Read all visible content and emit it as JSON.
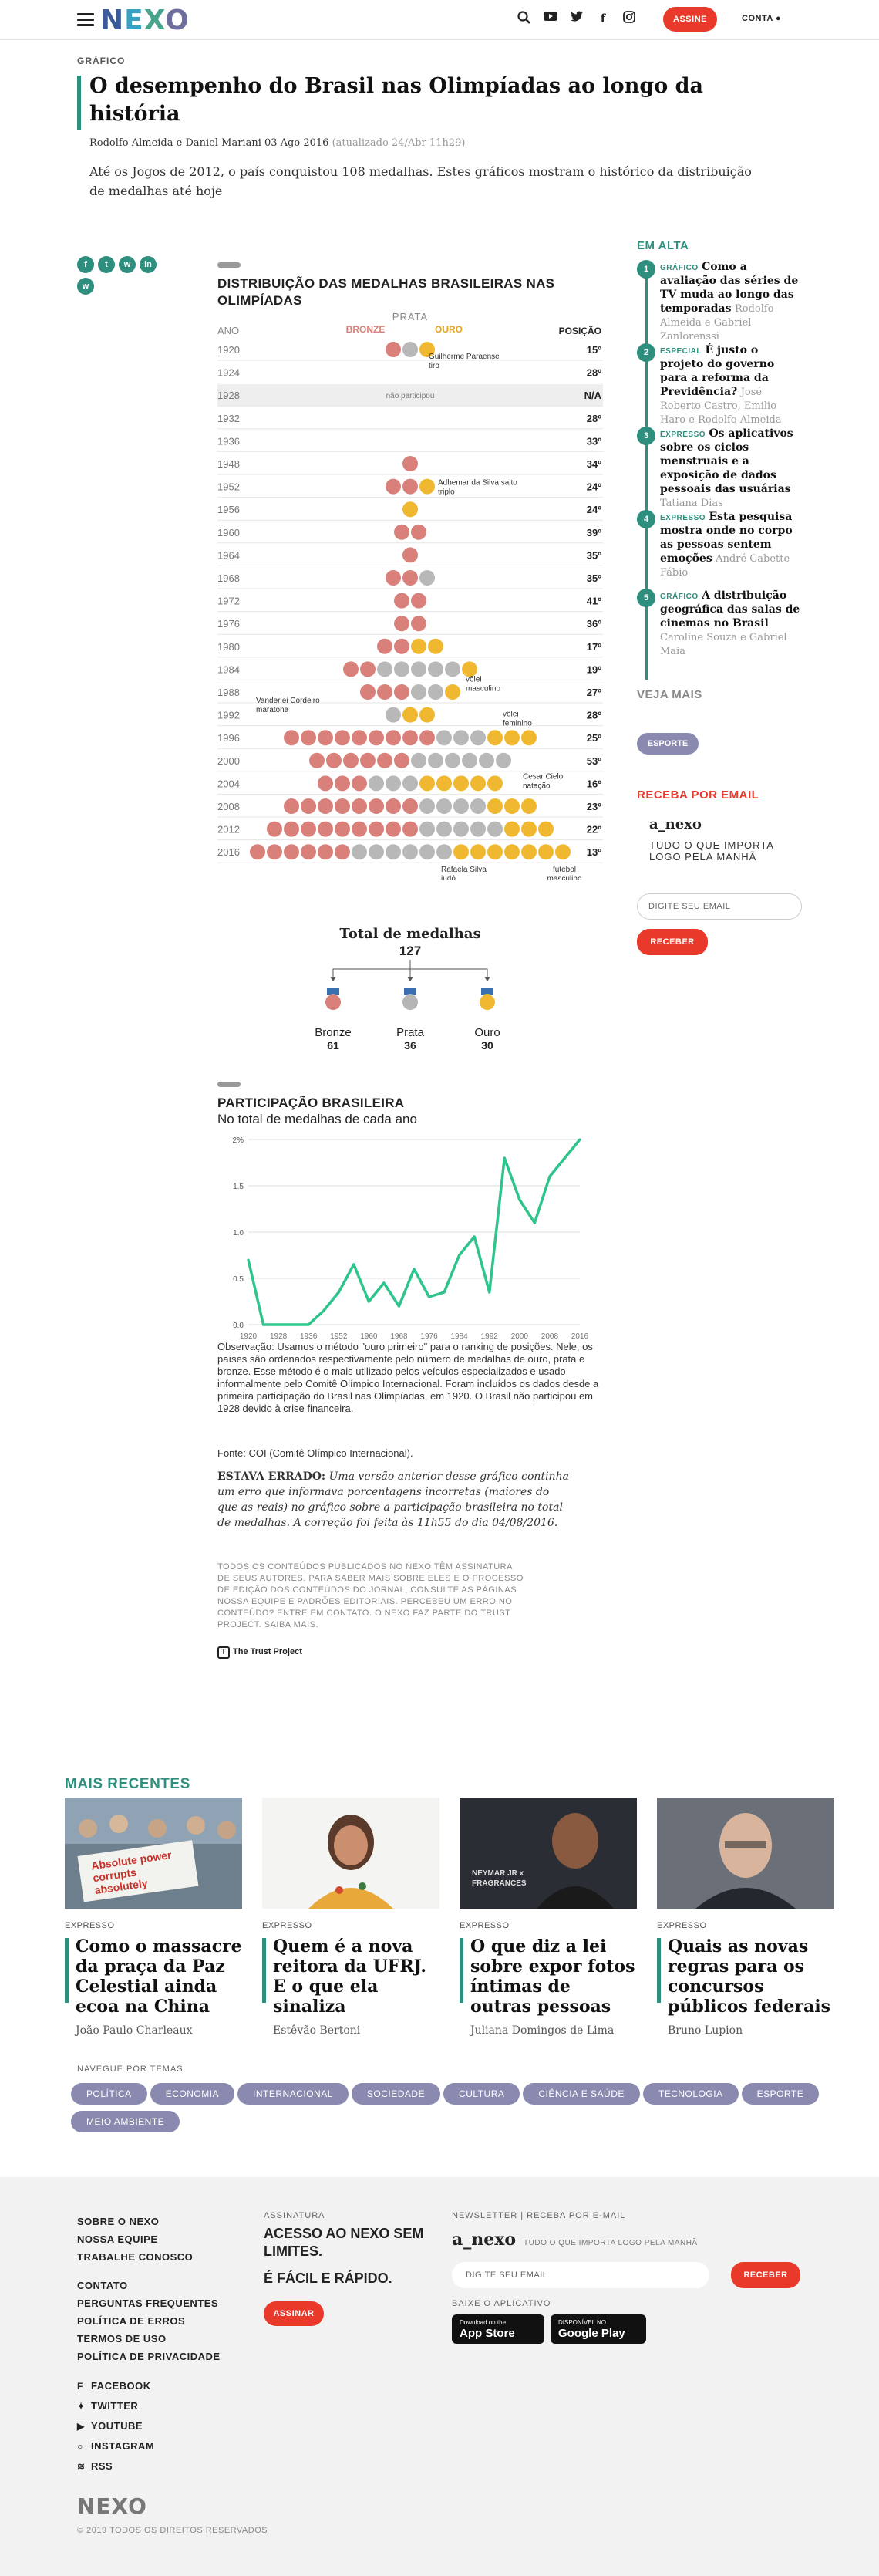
{
  "header": {
    "logo": [
      "N",
      "E",
      "X",
      "O"
    ],
    "assine": "ASSINE",
    "conta": "CONTA"
  },
  "article": {
    "kicker": "GRÁFICO",
    "title": "O desempenho do Brasil nas Olimpíadas ao longo da história",
    "byline": "Rodolfo Almeida e Daniel Mariani 03 Ago 2016",
    "updated": "(atualizado 24/Abr 11h29)",
    "lede": "Até os Jogos de 2012, o país conquistou 108 medalhas. Estes gráficos mostram o histórico da distribuição de medalhas até hoje"
  },
  "share_icons": [
    "facebook-icon",
    "twitter-icon",
    "whatsapp-icon",
    "linkedin-icon",
    "whatsapp-icon"
  ],
  "chart1": {
    "title": "DISTRIBUIÇÃO DAS MEDALHAS BRASILEIRAS NAS OLIMPÍADAS",
    "col_year": "ANO",
    "col_bronze": "BRONZE",
    "col_prata": "PRATA",
    "col_ouro": "OURO",
    "col_pos": "POSIÇÃO",
    "no_participation": "não participou",
    "rows": [
      {
        "year": "1920",
        "b": 1,
        "s": 1,
        "g": 1,
        "pos": "15º"
      },
      {
        "year": "1924",
        "b": 0,
        "s": 0,
        "g": 0,
        "pos": "28º"
      },
      {
        "year": "1928",
        "b": 0,
        "s": 0,
        "g": 0,
        "pos": "N/A",
        "np": true
      },
      {
        "year": "1932",
        "b": 0,
        "s": 0,
        "g": 0,
        "pos": "28º"
      },
      {
        "year": "1936",
        "b": 0,
        "s": 0,
        "g": 0,
        "pos": "33º"
      },
      {
        "year": "1948",
        "b": 1,
        "s": 0,
        "g": 0,
        "pos": "34º"
      },
      {
        "year": "1952",
        "b": 2,
        "s": 0,
        "g": 1,
        "pos": "24º"
      },
      {
        "year": "1956",
        "b": 0,
        "s": 0,
        "g": 1,
        "pos": "24º"
      },
      {
        "year": "1960",
        "b": 2,
        "s": 0,
        "g": 0,
        "pos": "39º"
      },
      {
        "year": "1964",
        "b": 1,
        "s": 0,
        "g": 0,
        "pos": "35º"
      },
      {
        "year": "1968",
        "b": 2,
        "s": 1,
        "g": 0,
        "pos": "35º"
      },
      {
        "year": "1972",
        "b": 2,
        "s": 0,
        "g": 0,
        "pos": "41º"
      },
      {
        "year": "1976",
        "b": 2,
        "s": 0,
        "g": 0,
        "pos": "36º"
      },
      {
        "year": "1980",
        "b": 2,
        "s": 0,
        "g": 2,
        "pos": "17º"
      },
      {
        "year": "1984",
        "b": 2,
        "s": 5,
        "g": 1,
        "pos": "19º"
      },
      {
        "year": "1988",
        "b": 3,
        "s": 2,
        "g": 1,
        "pos": "27º"
      },
      {
        "year": "1992",
        "b": 0,
        "s": 1,
        "g": 2,
        "pos": "28º"
      },
      {
        "year": "1996",
        "b": 9,
        "s": 3,
        "g": 3,
        "pos": "25º"
      },
      {
        "year": "2000",
        "b": 6,
        "s": 6,
        "g": 0,
        "pos": "53º"
      },
      {
        "year": "2004",
        "b": 3,
        "s": 3,
        "g": 5,
        "pos": "16º"
      },
      {
        "year": "2008",
        "b": 8,
        "s": 4,
        "g": 3,
        "pos": "23º"
      },
      {
        "year": "2012",
        "b": 9,
        "s": 5,
        "g": 3,
        "pos": "22º"
      },
      {
        "year": "2016",
        "b": 6,
        "s": 6,
        "g": 7,
        "pos": "13º"
      }
    ],
    "annotations": {
      "a1920": "Guilherme Paraense tiro",
      "a1952": "Adhemar da Silva salto triplo",
      "a1984": "vôlei masculino",
      "a1988": "Vanderlei Cordeiro maratona",
      "a1992": "vôlei feminino",
      "a2004": "Cesar Cielo natação",
      "a2016a": "Rafaela Silva judô",
      "a2016b": "futebol masculino"
    }
  },
  "totals": {
    "label": "Total de medalhas",
    "total": "127",
    "bronze_label": "Bronze",
    "bronze": "61",
    "prata_label": "Prata",
    "prata": "36",
    "ouro_label": "Ouro",
    "ouro": "30"
  },
  "chart_data": {
    "type": "line",
    "title": "PARTICIPAÇÃO BRASILEIRA",
    "subtitle": "No total de medalhas de cada ano",
    "x": [
      "1920",
      "1924",
      "1928",
      "1932",
      "1936",
      "1948",
      "1952",
      "1956",
      "1960",
      "1964",
      "1968",
      "1972",
      "1976",
      "1980",
      "1984",
      "1988",
      "1992",
      "1996",
      "2000",
      "2004",
      "2008",
      "2012",
      "2016"
    ],
    "values": [
      0.7,
      0,
      0,
      0,
      0,
      0.15,
      0.35,
      0.65,
      0.25,
      0.45,
      0.2,
      0.6,
      0.3,
      0.35,
      0.75,
      0.95,
      0.35,
      1.8,
      1.35,
      1.1,
      1.6,
      1.8,
      2.0
    ],
    "ylim": [
      0,
      2
    ],
    "yticks": [
      "0.0",
      "0.5",
      "1.0",
      "1.5",
      "2%"
    ],
    "xticks": [
      "1920",
      "1928",
      "1936",
      "1952",
      "1960",
      "1968",
      "1976",
      "1984",
      "1992",
      "2000",
      "2008",
      "2016"
    ],
    "color": "#2ec48c",
    "grid": true
  },
  "notes": {
    "obs": "Observação: Usamos o método \"ouro primeiro\" para o ranking de posições. Nele, os países são ordenados respectivamente pelo número de medalhas de ouro, prata e bronze. Esse método é o mais utilizado pelos veículos especializados e usado informalmente pelo Comitê Olímpico Internacional. Foram incluídos os dados desde a primeira participação do Brasil nas Olimpíadas, em 1920. O Brasil não participou em 1928 devido à crise financeira.",
    "fonte": "Fonte: COI (Comitê Olímpico Internacional).",
    "errata_head": "ESTAVA ERRADO:",
    "errata": "Uma versão anterior desse gráfico continha um erro que informava porcentagens incorretas (maiores do que as reais) no gráfico sobre a participação brasileira no total de medalhas. A correção foi feita às 11h55 do dia 04/08/2016.",
    "transparency": "TODOS OS CONTEÚDOS PUBLICADOS NO NEXO TÊM ASSINATURA DE SEUS AUTORES. PARA SABER MAIS SOBRE ELES E O PROCESSO DE EDIÇÃO DOS CONTEÚDOS DO JORNAL, CONSULTE AS PÁGINAS NOSSA EQUIPE E PADRÕES EDITORIAIS. PERCEBEU UM ERRO NO CONTEÚDO? ENTRE EM CONTATO. O NEXO FAZ PARTE DO TRUST PROJECT. SAIBA MAIS.",
    "trust": "The Trust Project"
  },
  "sidebar": {
    "heading": "EM ALTA",
    "items": [
      {
        "n": "1",
        "tag": "GRÁFICO",
        "title": "Como a avaliação das séries de TV muda ao longo das temporadas",
        "author": "Rodolfo Almeida e Gabriel Zanlorenssi"
      },
      {
        "n": "2",
        "tag": "ESPECIAL",
        "title": "É justo o projeto do governo para a reforma da Previdência?",
        "author": "José Roberto Castro, Emilio Haro e Rodolfo Almeida"
      },
      {
        "n": "3",
        "tag": "EXPRESSO",
        "title": "Os aplicativos sobre os ciclos menstruais e a exposição de dados pessoais das usuárias",
        "author": "Tatiana Dias"
      },
      {
        "n": "4",
        "tag": "EXPRESSO",
        "title": "Esta pesquisa mostra onde no corpo as pessoas sentem emoções",
        "author": "André Cabette Fábio"
      },
      {
        "n": "5",
        "tag": "GRÁFICO",
        "title": "A distribuição geográfica das salas de cinemas no Brasil",
        "author": "Caroline Souza e Gabriel Maia"
      }
    ],
    "veja_mais": "VEJA MAIS",
    "esporte": "ESPORTE",
    "receba": "RECEBA POR EMAIL",
    "anexo": "a_nexo",
    "anexo_sub": "TUDO O QUE IMPORTA LOGO PELA MANHÃ",
    "email_placeholder": "DIGITE SEU EMAIL",
    "receber": "RECEBER"
  },
  "recentes": {
    "heading": "MAIS RECENTES",
    "cards": [
      {
        "tag": "EXPRESSO",
        "title": "Como o massacre da praça da Paz Celestial ainda ecoa na China",
        "author": "João Paulo Charleaux"
      },
      {
        "tag": "EXPRESSO",
        "title": "Quem é a nova reitora da UFRJ. E o que ela sinaliza",
        "author": "Estêvão Bertoni"
      },
      {
        "tag": "EXPRESSO",
        "title": "O que diz a lei sobre expor fotos íntimas de outras pessoas",
        "author": "Juliana Domingos de Lima"
      },
      {
        "tag": "EXPRESSO",
        "title": "Quais as novas regras para os concursos públicos federais",
        "author": "Bruno Lupion"
      }
    ],
    "img1_text": "Absolute power corrupts absolutely",
    "img3_text": "NEYMAR JR x FRAGRANCES"
  },
  "temas": {
    "label": "NAVEGUE POR TEMAS",
    "items": [
      "POLÍTICA",
      "ECONOMIA",
      "INTERNACIONAL",
      "SOCIEDADE",
      "CULTURA",
      "CIÊNCIA E SAÚDE",
      "TECNOLOGIA",
      "ESPORTE",
      "MEIO AMBIENTE"
    ]
  },
  "footer": {
    "links1": [
      "SOBRE O NEXO",
      "NOSSA EQUIPE",
      "TRABALHE CONOSCO"
    ],
    "links2": [
      "CONTATO",
      "PERGUNTAS FREQUENTES",
      "POLÍTICA DE ERROS",
      "TERMOS DE USO",
      "POLÍTICA DE PRIVACIDADE"
    ],
    "social": [
      "FACEBOOK",
      "TWITTER",
      "YOUTUBE",
      "INSTAGRAM",
      "RSS"
    ],
    "assinatura_label": "ASSINATURA",
    "assinatura_big1": "ACESSO AO NEXO SEM LIMITES.",
    "assinatura_big2": "É FÁCIL E RÁPIDO.",
    "assinar": "ASSINAR",
    "news_label": "NEWSLETTER | RECEBA POR E-MAIL",
    "anexo": "a_nexo",
    "anexo_sub": "TUDO O QUE IMPORTA LOGO PELA MANHÃ",
    "email_placeholder": "DIGITE SEU EMAIL",
    "receber": "RECEBER",
    "baixe": "BAIXE O APLICATIVO",
    "appstore_small": "Download on the",
    "appstore": "App Store",
    "gplay_small": "DISPONÍVEL NO",
    "gplay": "Google Play",
    "logo": "NEXO",
    "copyright": "© 2019 TODOS OS DIREITOS RESERVADOS"
  }
}
